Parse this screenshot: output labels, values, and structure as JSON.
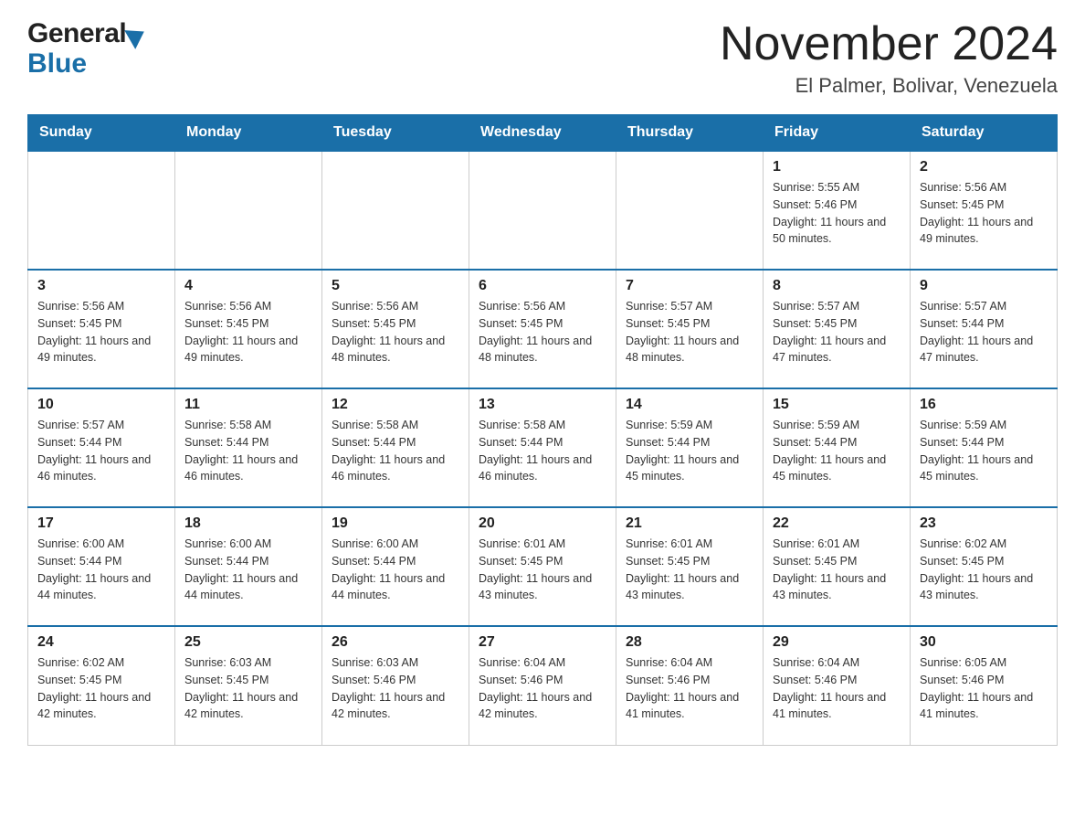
{
  "logo": {
    "general": "General",
    "blue": "Blue"
  },
  "title": {
    "month": "November 2024",
    "location": "El Palmer, Bolivar, Venezuela"
  },
  "weekdays": [
    "Sunday",
    "Monday",
    "Tuesday",
    "Wednesday",
    "Thursday",
    "Friday",
    "Saturday"
  ],
  "weeks": [
    [
      {
        "day": "",
        "sunrise": "",
        "sunset": "",
        "daylight": ""
      },
      {
        "day": "",
        "sunrise": "",
        "sunset": "",
        "daylight": ""
      },
      {
        "day": "",
        "sunrise": "",
        "sunset": "",
        "daylight": ""
      },
      {
        "day": "",
        "sunrise": "",
        "sunset": "",
        "daylight": ""
      },
      {
        "day": "",
        "sunrise": "",
        "sunset": "",
        "daylight": ""
      },
      {
        "day": "1",
        "sunrise": "Sunrise: 5:55 AM",
        "sunset": "Sunset: 5:46 PM",
        "daylight": "Daylight: 11 hours and 50 minutes."
      },
      {
        "day": "2",
        "sunrise": "Sunrise: 5:56 AM",
        "sunset": "Sunset: 5:45 PM",
        "daylight": "Daylight: 11 hours and 49 minutes."
      }
    ],
    [
      {
        "day": "3",
        "sunrise": "Sunrise: 5:56 AM",
        "sunset": "Sunset: 5:45 PM",
        "daylight": "Daylight: 11 hours and 49 minutes."
      },
      {
        "day": "4",
        "sunrise": "Sunrise: 5:56 AM",
        "sunset": "Sunset: 5:45 PM",
        "daylight": "Daylight: 11 hours and 49 minutes."
      },
      {
        "day": "5",
        "sunrise": "Sunrise: 5:56 AM",
        "sunset": "Sunset: 5:45 PM",
        "daylight": "Daylight: 11 hours and 48 minutes."
      },
      {
        "day": "6",
        "sunrise": "Sunrise: 5:56 AM",
        "sunset": "Sunset: 5:45 PM",
        "daylight": "Daylight: 11 hours and 48 minutes."
      },
      {
        "day": "7",
        "sunrise": "Sunrise: 5:57 AM",
        "sunset": "Sunset: 5:45 PM",
        "daylight": "Daylight: 11 hours and 48 minutes."
      },
      {
        "day": "8",
        "sunrise": "Sunrise: 5:57 AM",
        "sunset": "Sunset: 5:45 PM",
        "daylight": "Daylight: 11 hours and 47 minutes."
      },
      {
        "day": "9",
        "sunrise": "Sunrise: 5:57 AM",
        "sunset": "Sunset: 5:44 PM",
        "daylight": "Daylight: 11 hours and 47 minutes."
      }
    ],
    [
      {
        "day": "10",
        "sunrise": "Sunrise: 5:57 AM",
        "sunset": "Sunset: 5:44 PM",
        "daylight": "Daylight: 11 hours and 46 minutes."
      },
      {
        "day": "11",
        "sunrise": "Sunrise: 5:58 AM",
        "sunset": "Sunset: 5:44 PM",
        "daylight": "Daylight: 11 hours and 46 minutes."
      },
      {
        "day": "12",
        "sunrise": "Sunrise: 5:58 AM",
        "sunset": "Sunset: 5:44 PM",
        "daylight": "Daylight: 11 hours and 46 minutes."
      },
      {
        "day": "13",
        "sunrise": "Sunrise: 5:58 AM",
        "sunset": "Sunset: 5:44 PM",
        "daylight": "Daylight: 11 hours and 46 minutes."
      },
      {
        "day": "14",
        "sunrise": "Sunrise: 5:59 AM",
        "sunset": "Sunset: 5:44 PM",
        "daylight": "Daylight: 11 hours and 45 minutes."
      },
      {
        "day": "15",
        "sunrise": "Sunrise: 5:59 AM",
        "sunset": "Sunset: 5:44 PM",
        "daylight": "Daylight: 11 hours and 45 minutes."
      },
      {
        "day": "16",
        "sunrise": "Sunrise: 5:59 AM",
        "sunset": "Sunset: 5:44 PM",
        "daylight": "Daylight: 11 hours and 45 minutes."
      }
    ],
    [
      {
        "day": "17",
        "sunrise": "Sunrise: 6:00 AM",
        "sunset": "Sunset: 5:44 PM",
        "daylight": "Daylight: 11 hours and 44 minutes."
      },
      {
        "day": "18",
        "sunrise": "Sunrise: 6:00 AM",
        "sunset": "Sunset: 5:44 PM",
        "daylight": "Daylight: 11 hours and 44 minutes."
      },
      {
        "day": "19",
        "sunrise": "Sunrise: 6:00 AM",
        "sunset": "Sunset: 5:44 PM",
        "daylight": "Daylight: 11 hours and 44 minutes."
      },
      {
        "day": "20",
        "sunrise": "Sunrise: 6:01 AM",
        "sunset": "Sunset: 5:45 PM",
        "daylight": "Daylight: 11 hours and 43 minutes."
      },
      {
        "day": "21",
        "sunrise": "Sunrise: 6:01 AM",
        "sunset": "Sunset: 5:45 PM",
        "daylight": "Daylight: 11 hours and 43 minutes."
      },
      {
        "day": "22",
        "sunrise": "Sunrise: 6:01 AM",
        "sunset": "Sunset: 5:45 PM",
        "daylight": "Daylight: 11 hours and 43 minutes."
      },
      {
        "day": "23",
        "sunrise": "Sunrise: 6:02 AM",
        "sunset": "Sunset: 5:45 PM",
        "daylight": "Daylight: 11 hours and 43 minutes."
      }
    ],
    [
      {
        "day": "24",
        "sunrise": "Sunrise: 6:02 AM",
        "sunset": "Sunset: 5:45 PM",
        "daylight": "Daylight: 11 hours and 42 minutes."
      },
      {
        "day": "25",
        "sunrise": "Sunrise: 6:03 AM",
        "sunset": "Sunset: 5:45 PM",
        "daylight": "Daylight: 11 hours and 42 minutes."
      },
      {
        "day": "26",
        "sunrise": "Sunrise: 6:03 AM",
        "sunset": "Sunset: 5:46 PM",
        "daylight": "Daylight: 11 hours and 42 minutes."
      },
      {
        "day": "27",
        "sunrise": "Sunrise: 6:04 AM",
        "sunset": "Sunset: 5:46 PM",
        "daylight": "Daylight: 11 hours and 42 minutes."
      },
      {
        "day": "28",
        "sunrise": "Sunrise: 6:04 AM",
        "sunset": "Sunset: 5:46 PM",
        "daylight": "Daylight: 11 hours and 41 minutes."
      },
      {
        "day": "29",
        "sunrise": "Sunrise: 6:04 AM",
        "sunset": "Sunset: 5:46 PM",
        "daylight": "Daylight: 11 hours and 41 minutes."
      },
      {
        "day": "30",
        "sunrise": "Sunrise: 6:05 AM",
        "sunset": "Sunset: 5:46 PM",
        "daylight": "Daylight: 11 hours and 41 minutes."
      }
    ]
  ]
}
